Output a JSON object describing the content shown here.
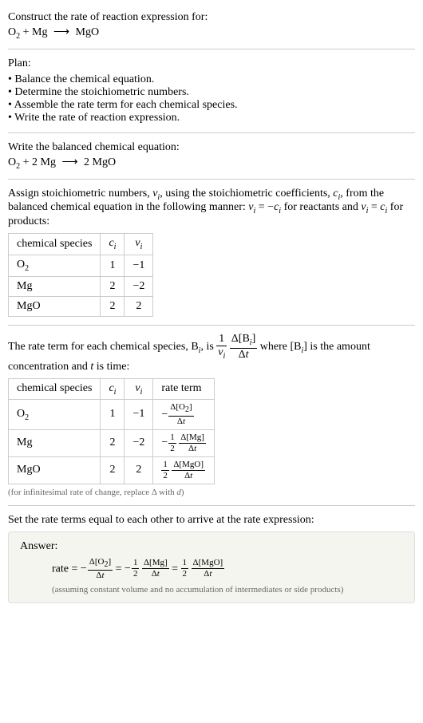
{
  "header": {
    "prompt": "Construct the rate of reaction expression for:",
    "equation_o2": "O",
    "equation_sub2": "2",
    "equation_plus_mg": " + Mg ",
    "equation_arrow": "⟶",
    "equation_mgo": " MgO"
  },
  "plan": {
    "title": "Plan:",
    "items": [
      "Balance the chemical equation.",
      "Determine the stoichiometric numbers.",
      "Assemble the rate term for each chemical species.",
      "Write the rate of reaction expression."
    ]
  },
  "balanced": {
    "title": "Write the balanced chemical equation:",
    "o2": "O",
    "sub2": "2",
    "plus_2mg": " + 2 Mg ",
    "arrow": "⟶",
    "rhs": " 2 MgO"
  },
  "stoich": {
    "intro_1": "Assign stoichiometric numbers, ",
    "nu_i": "ν",
    "intro_2": ", using the stoichiometric coefficients, ",
    "c_i": "c",
    "intro_3": ", from the balanced chemical equation in the following manner: ",
    "eq1_lhs": "ν",
    "eq1_mid": " = −",
    "eq1_rhs": "c",
    "intro_4": " for reactants and ",
    "eq2_lhs": "ν",
    "eq2_mid": " = ",
    "eq2_rhs": "c",
    "intro_5": " for products:",
    "table": {
      "h1": "chemical species",
      "h2": "c",
      "h3": "ν",
      "rows": [
        {
          "species": "O",
          "sub": "2",
          "c": "1",
          "nu": "−1"
        },
        {
          "species": "Mg",
          "sub": "",
          "c": "2",
          "nu": "−2"
        },
        {
          "species": "MgO",
          "sub": "",
          "c": "2",
          "nu": "2"
        }
      ]
    }
  },
  "rateterm": {
    "intro_1": "The rate term for each chemical species, B",
    "intro_2": ", is ",
    "frac1_num": "1",
    "frac1_den_nu": "ν",
    "frac2_num": "Δ[B",
    "frac2_num_close": "]",
    "frac2_den": "Δt",
    "intro_3": " where [B",
    "intro_4": "] is the amount concentration and ",
    "t_var": "t",
    "intro_5": " is time:",
    "table": {
      "h1": "chemical species",
      "h2": "c",
      "h3": "ν",
      "h4": "rate term",
      "rows": [
        {
          "species": "O",
          "sub": "2",
          "c": "1",
          "nu": "−1"
        },
        {
          "species": "Mg",
          "sub": "",
          "c": "2",
          "nu": "−2"
        },
        {
          "species": "MgO",
          "sub": "",
          "c": "2",
          "nu": "2"
        }
      ]
    },
    "note": "(for infinitesimal rate of change, replace Δ with d)",
    "term_o2_num": "Δ[O",
    "term_o2_num_close": "]",
    "term_mg_num": "Δ[Mg]",
    "term_mgo_num": "Δ[MgO]",
    "term_den": "Δt",
    "half_num": "1",
    "half_den": "2"
  },
  "final": {
    "title": "Set the rate terms equal to each other to arrive at the rate expression:",
    "answer_label": "Answer:",
    "rate_eq": "rate = ",
    "minus": "−",
    "eq": " = ",
    "o2_num": "Δ[O",
    "o2_close": "]",
    "den": "Δt",
    "half_num": "1",
    "half_den": "2",
    "mg_num": "Δ[Mg]",
    "mgo_num": "Δ[MgO]",
    "note": "(assuming constant volume and no accumulation of intermediates or side products)"
  }
}
